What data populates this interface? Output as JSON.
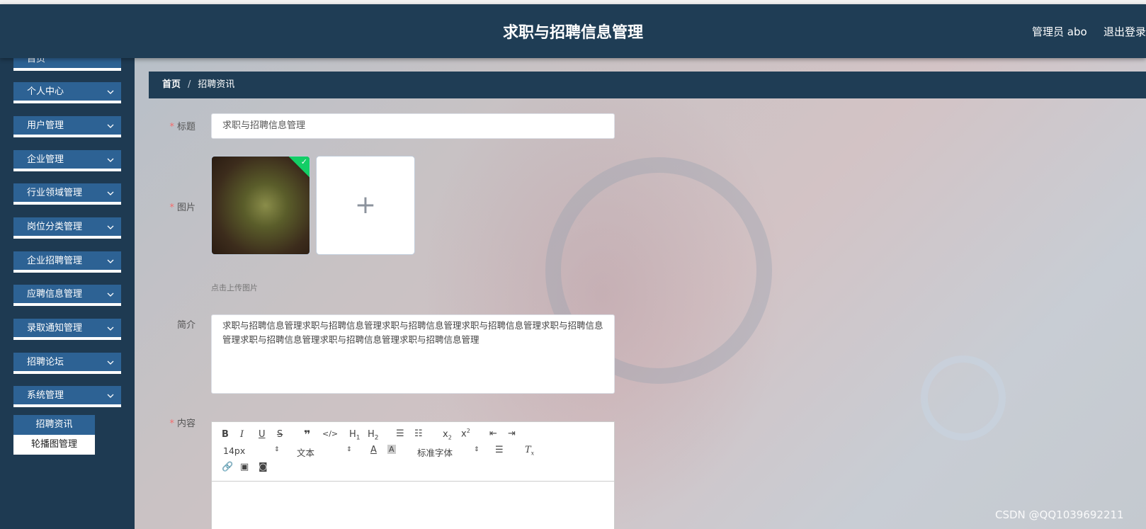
{
  "header": {
    "title": "求职与招聘信息管理",
    "user": "管理员 abo",
    "logout": "退出登录"
  },
  "sidebar": {
    "items": [
      {
        "label": "首页"
      },
      {
        "label": "个人中心"
      },
      {
        "label": "用户管理"
      },
      {
        "label": "企业管理"
      },
      {
        "label": "行业领域管理"
      },
      {
        "label": "岗位分类管理"
      },
      {
        "label": "企业招聘管理"
      },
      {
        "label": "应聘信息管理"
      },
      {
        "label": "录取通知管理"
      },
      {
        "label": "招聘论坛"
      },
      {
        "label": "系统管理"
      }
    ],
    "sub_items": [
      {
        "label": "招聘资讯",
        "active": true
      },
      {
        "label": "轮播图管理",
        "active": false
      }
    ]
  },
  "breadcrumb": {
    "home": "首页",
    "separator": "/",
    "current": "招聘资讯"
  },
  "form": {
    "title_label": "标题",
    "title_value": "求职与招聘信息管理",
    "image_label": "图片",
    "upload_hint": "点击上传图片",
    "summary_label": "简介",
    "summary_value": "求职与招聘信息管理求职与招聘信息管理求职与招聘信息管理求职与招聘信息管理求职与招聘信息管理求职与招聘信息管理求职与招聘信息管理求职与招聘信息管理",
    "content_label": "内容"
  },
  "editor": {
    "font_size": "14px",
    "text_type": "文本",
    "font_family": "标准字体"
  },
  "watermark": "CSDN @QQ1039692211",
  "colors": {
    "header_bg": "#1f3d55",
    "menu_bg": "#2d6294",
    "required": "#f56c6c",
    "success": "#13ce66"
  }
}
